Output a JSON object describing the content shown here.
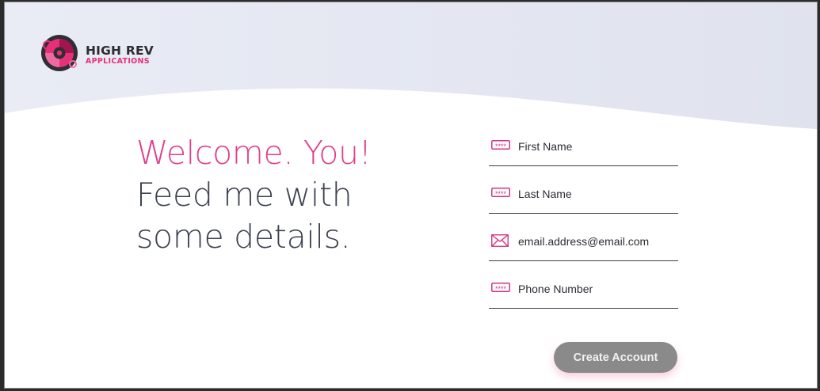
{
  "brand": {
    "name_line1": "HIGH REV",
    "name_line2": "APPLICATIONS",
    "accent_color": "#e03f8c",
    "hero_color": "#e3e6f0"
  },
  "headline": {
    "line1": "Welcome. You!",
    "line2": "Feed me with",
    "line3": "some details."
  },
  "form": {
    "fields": [
      {
        "icon": "password-dots-icon",
        "placeholder": "First Name",
        "value": ""
      },
      {
        "icon": "password-dots-icon",
        "placeholder": "Last Name",
        "value": ""
      },
      {
        "icon": "envelope-icon",
        "placeholder": "email.address@email.com",
        "value": ""
      },
      {
        "icon": "password-dots-icon",
        "placeholder": "Phone Number",
        "value": ""
      }
    ],
    "submit_label": "Create Account"
  }
}
